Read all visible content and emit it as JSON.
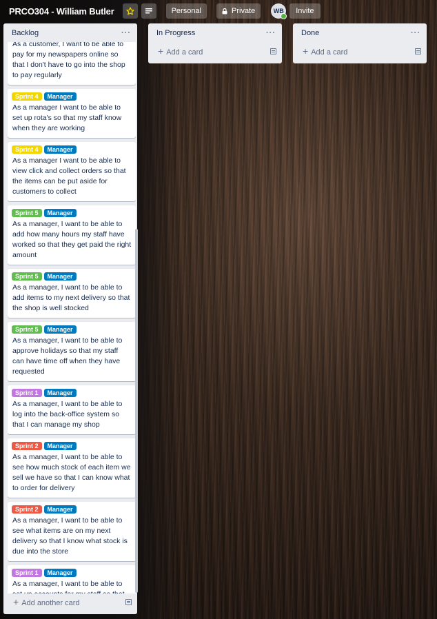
{
  "header": {
    "board_title": "PRCO304 - William Butler",
    "personal_label": "Personal",
    "private_label": "Private",
    "avatar_initials": "WB",
    "invite_label": "Invite"
  },
  "colors": {
    "sprint_1": "#c377e0",
    "sprint_2": "#eb5a46",
    "sprint_4": "#f2d600",
    "sprint_5": "#61bd4f",
    "manager": "#0079bf"
  },
  "lists": [
    {
      "title": "Backlog",
      "add_label": "Add another card",
      "cards": [
        {
          "labels": [],
          "text": "As a customer, I want to be able to pay for my newspapers online so that I don't have to go into the shop to pay regularly"
        },
        {
          "labels": [
            {
              "text": "Sprint 4",
              "color": "#f2d600"
            },
            {
              "text": "Manager",
              "color": "#0079bf"
            }
          ],
          "text": "As a manager I want to be able to set up rota's so that my staff know when they are working"
        },
        {
          "labels": [
            {
              "text": "Sprint 4",
              "color": "#f2d600"
            },
            {
              "text": "Manager",
              "color": "#0079bf"
            }
          ],
          "text": "As a manager I want to be able to view click and collect orders so that the items can be put aside for customers to collect"
        },
        {
          "labels": [
            {
              "text": "Sprint 5",
              "color": "#61bd4f"
            },
            {
              "text": "Manager",
              "color": "#0079bf"
            }
          ],
          "text": "As a manager, I want to be able to add how many hours my staff have worked so that they get paid the right amount"
        },
        {
          "labels": [
            {
              "text": "Sprint 5",
              "color": "#61bd4f"
            },
            {
              "text": "Manager",
              "color": "#0079bf"
            }
          ],
          "text": "As a manager, I want to be able to add items to my next delivery so that the shop is well stocked"
        },
        {
          "labels": [
            {
              "text": "Sprint 5",
              "color": "#61bd4f"
            },
            {
              "text": "Manager",
              "color": "#0079bf"
            }
          ],
          "text": "As a manager, I want to be able to approve holidays so that my staff can have time off when they have requested"
        },
        {
          "labels": [
            {
              "text": "Sprint 1",
              "color": "#c377e0"
            },
            {
              "text": "Manager",
              "color": "#0079bf"
            }
          ],
          "text": "As a manager, I want to be able to log into the back-office system so that I can manage my shop"
        },
        {
          "labels": [
            {
              "text": "Sprint 2",
              "color": "#eb5a46"
            },
            {
              "text": "Manager",
              "color": "#0079bf"
            }
          ],
          "text": "As a manager, I want to be able to see how much stock of each item we sell we have so that I can know what to order for delivery"
        },
        {
          "labels": [
            {
              "text": "Sprint 2",
              "color": "#eb5a46"
            },
            {
              "text": "Manager",
              "color": "#0079bf"
            }
          ],
          "text": "As a manager, I want to be able to see what items are on my next delivery so that I know what stock is due into the store"
        },
        {
          "labels": [
            {
              "text": "Sprint 1",
              "color": "#c377e0"
            },
            {
              "text": "Manager",
              "color": "#0079bf"
            }
          ],
          "text": "As a manager, I want to be able to set up accounts for my staff so that they can access the system"
        }
      ]
    },
    {
      "title": "In Progress",
      "add_label": "Add a card",
      "cards": []
    },
    {
      "title": "Done",
      "add_label": "Add a card",
      "cards": []
    }
  ]
}
